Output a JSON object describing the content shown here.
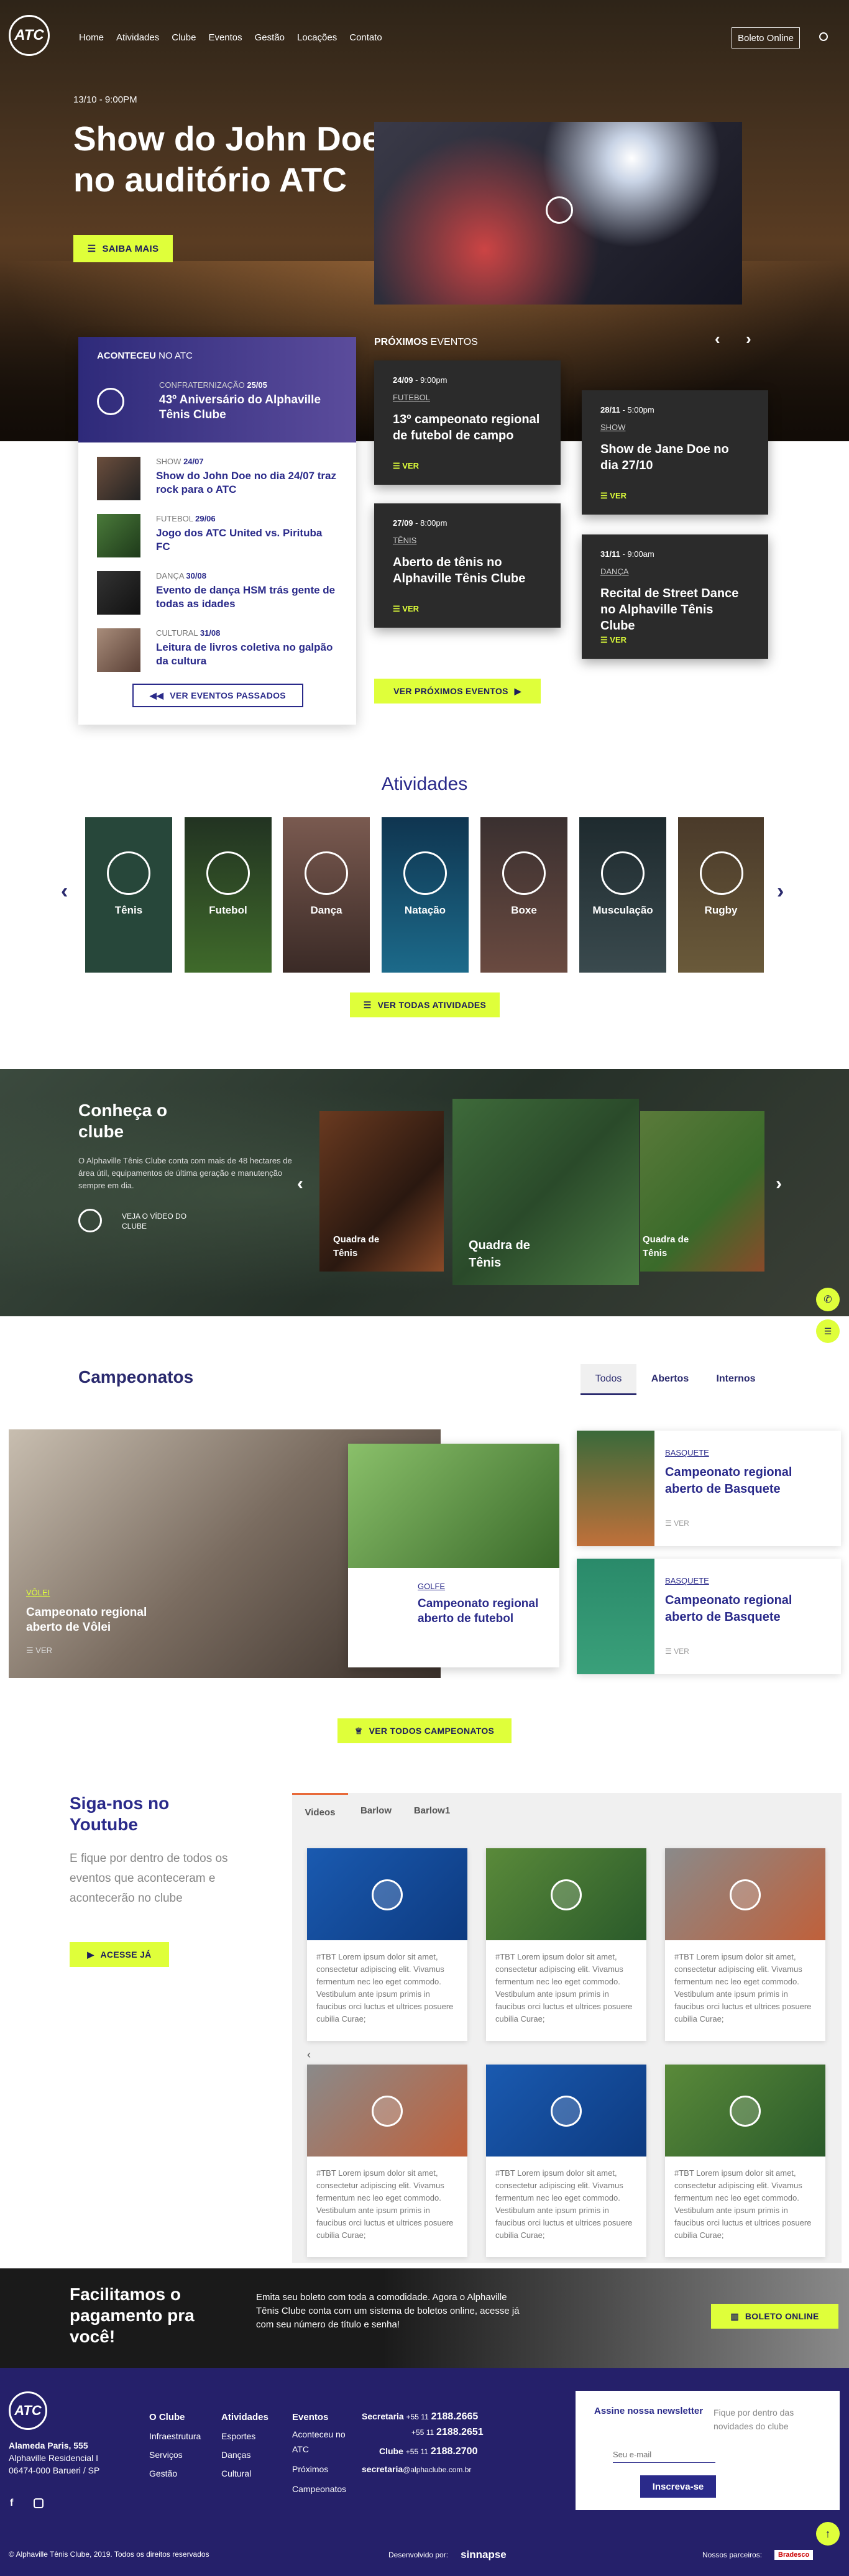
{
  "header": {
    "logo": "ATC",
    "nav": [
      "Home",
      "Atividades",
      "Clube",
      "Eventos",
      "Gestão",
      "Locações",
      "Contato"
    ],
    "boleto": "Boleto Online"
  },
  "hero": {
    "date": "13/10 - 9:00PM",
    "title": "Show do John Doe no auditório ATC",
    "cta": "SAIBA MAIS"
  },
  "past": {
    "heading_bold": "ACONTECEU",
    "heading_rest": " NO ATC",
    "featured_cat": "CONFRATERNIZAÇÃO",
    "featured_date": "25/05",
    "featured_title": "43º Aniversário do Alphaville Tênis Clube",
    "items": [
      {
        "cat": "SHOW",
        "date": "24/07",
        "title": "Show do John Doe no dia 24/07 traz rock para o ATC"
      },
      {
        "cat": "FUTEBOL",
        "date": "29/06",
        "title": "Jogo dos ATC United vs. Pirituba FC"
      },
      {
        "cat": "DANÇA",
        "date": "30/08",
        "title": "Evento de dança HSM trás gente de todas as idades"
      },
      {
        "cat": "CULTURAL",
        "date": "31/08",
        "title": "Leitura de livros coletiva no galpão da cultura"
      }
    ],
    "button": "VER EVENTOS PASSADOS"
  },
  "upcoming": {
    "heading_bold": "PRÓXIMOS",
    "heading_rest": " EVENTOS",
    "cards": [
      {
        "date": "24/09",
        "time": " - 9:00pm",
        "cat": "FUTEBOL",
        "title": "13º campeonato regional de futebol de campo",
        "cta": "VER"
      },
      {
        "date": "28/11",
        "time": " - 5:00pm",
        "cat": "SHOW",
        "title": "Show de Jane Doe no dia 27/10",
        "cta": "VER"
      },
      {
        "date": "27/09",
        "time": " - 8:00pm",
        "cat": "TÊNIS",
        "title": "Aberto de tênis no Alphaville Tênis Clube",
        "cta": "VER"
      },
      {
        "date": "31/11",
        "time": " - 9:00am",
        "cat": "DANÇA",
        "title": "Recital de Street Dance no Alphaville Tênis Clube",
        "cta": "VER"
      }
    ],
    "button": "VER PRÓXIMOS EVENTOS"
  },
  "activities": {
    "title": "Atividades",
    "items": [
      "Tênis",
      "Futebol",
      "Dança",
      "Natação",
      "Boxe",
      "Musculação",
      "Rugby"
    ],
    "button": "VER TODAS ATIVIDADES"
  },
  "club": {
    "title": "Conheça o clube",
    "text": "O Alphaville Tênis Clube conta com mais de 48 hectares de área útil, equipamentos de última geração e manutenção sempre em dia.",
    "video": "VEJA O VÍDEO DO CLUBE",
    "slides": [
      "Quadra de Tênis",
      "Quadra de Tênis",
      "Quadra de Tênis"
    ]
  },
  "championships": {
    "title": "Campeonatos",
    "tabs": [
      "Todos",
      "Abertos",
      "Internos"
    ],
    "main_cat": "VÔLEI",
    "main_title": "Campeonato regional aberto de Vôlei",
    "main_cta": "VER",
    "second_cat": "GOLFE",
    "second_title": "Campeonato regional aberto de futebol",
    "side": [
      {
        "cat": "BASQUETE",
        "title": "Campeonato regional aberto de Basquete",
        "cta": "VER"
      },
      {
        "cat": "BASQUETE",
        "title": "Campeonato regional aberto de Basquete",
        "cta": "VER"
      }
    ],
    "button": "VER TODOS CAMPEONATOS"
  },
  "youtube": {
    "title": "Siga-nos no Youtube",
    "text": "E fique por dentro de todos os eventos que aconteceram e acontecerão no clube",
    "cta": "ACESSE JÁ",
    "tabs": [
      "Videos",
      "Barlow",
      "Barlow1"
    ],
    "video_text": "#TBT Lorem ipsum dolor sit amet, consectetur adipiscing elit. Vivamus fermentum nec leo eget commodo. Vestibulum ante ipsum primis in faucibus orci luctus et ultrices posuere cubilia Curae;"
  },
  "boleto": {
    "title": "Facilitamos o pagamento pra você!",
    "text": "Emita seu boleto com toda a comodidade. Agora o Alphaville Tênis Clube conta com um sistema de boletos online, acesse já com seu número de título e senha!",
    "cta": "BOLETO ONLINE"
  },
  "footer": {
    "address_bold": "Alameda Paris, 555",
    "address_rest": " Alphaville Residencial I 06474-000 Barueri / SP",
    "cols": [
      {
        "title": "O Clube",
        "items": [
          "Infraestrutura",
          "Serviços",
          "Gestão"
        ]
      },
      {
        "title": "Atividades",
        "items": [
          "Esportes",
          "Danças",
          "Cultural"
        ]
      },
      {
        "title": "Eventos",
        "items": [
          "Aconteceu no ATC",
          "Próximos",
          "Campeonatos"
        ]
      }
    ],
    "contacts": [
      {
        "label": "Secretaria",
        "prefix": "+55 11",
        "nums": "2188.2665"
      },
      {
        "label": "",
        "prefix": "+55 11",
        "nums": "2188.2651"
      },
      {
        "label": "Clube",
        "prefix": "+55 11",
        "nums": "2188.2700"
      }
    ],
    "email_label": "secretaria",
    "email": "@alphaclube.com.br",
    "newsletter": {
      "title": "Assine nossa newsletter",
      "sub": "Fique por dentro das novidades do clube",
      "placeholder": "Seu e-mail",
      "button": "Inscreva-se"
    },
    "copyright": "© Alphaville Tênis Clube, 2019. Todos os direitos reservados",
    "dev": "Desenvolvido por:",
    "dev_name": "sinnapse",
    "partners": "Nossos parceiros:",
    "partner_name": "Bradesco"
  }
}
